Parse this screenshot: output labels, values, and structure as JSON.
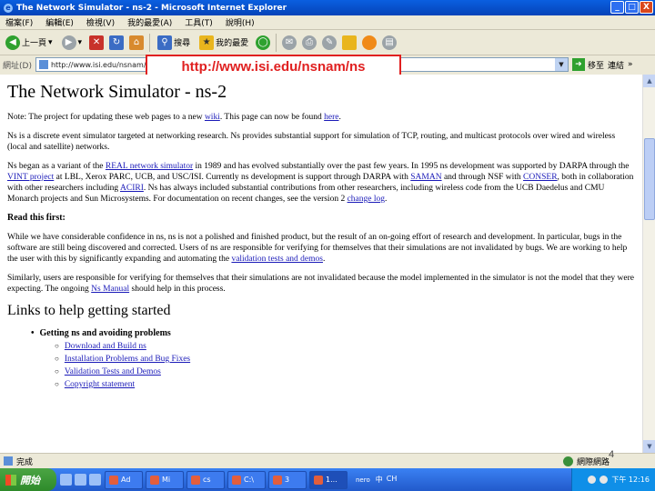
{
  "window": {
    "title": "The Network Simulator - ns-2 - Microsoft Internet Explorer",
    "controls": [
      "_",
      "□",
      "X"
    ]
  },
  "menu": [
    "檔案(F)",
    "編輯(E)",
    "檢視(V)",
    "我的最愛(A)",
    "工具(T)",
    "說明(H)"
  ],
  "toolbar": {
    "back_label": "上一頁",
    "search_label": "搜尋",
    "favorites_label": "我的最愛"
  },
  "address": {
    "label": "網址(D)",
    "value": "http://www.isi.edu/nsnam/ns/",
    "go_label": "移至",
    "links_label": "連結"
  },
  "callout": "http://www.isi.edu/nsnam/ns",
  "page": {
    "title": "The Network Simulator - ns-2",
    "note": {
      "pre": "Note: The project for updating these web pages to a new ",
      "link1": "wiki",
      "mid": ". This page can now be found ",
      "link2": "here",
      "post": "."
    },
    "p1": "Ns is a discrete event simulator targeted at networking research. Ns provides substantial support for simulation of TCP, routing, and multicast protocols over wired and wireless (local and satellite) networks.",
    "p2": {
      "a": "Ns began as a variant of the ",
      "l1": "REAL network simulator",
      "b": " in 1989 and has evolved substantially over the past few years. In 1995 ns development was supported by DARPA through the ",
      "l2": "VINT project",
      "c": " at LBL, Xerox PARC, UCB, and USC/ISI. Currently ns development is support through DARPA with ",
      "l3": "SAMAN",
      "d": " and through NSF with ",
      "l4": "CONSER",
      "e": ", both in collaboration with other researchers including ",
      "l5": "ACIRI",
      "f": ". Ns has always included substantial contributions from other researchers, including wireless code from the UCB Daedelus and CMU Monarch projects and Sun Microsystems. For documentation on recent changes, see the version 2 ",
      "l6": "change log",
      "g": "."
    },
    "read_first": "Read this first:",
    "p3": {
      "a": "While we have considerable confidence in ns, ns is not a polished and finished product, but the result of an on-going effort of research and development. In particular, bugs in the software are still being discovered and corrected. Users of ns are responsible for verifying for themselves that their simulations are not invalidated by bugs. We are working to help the user with this by significantly expanding and automating the ",
      "l1": "validation tests and demos",
      "b": "."
    },
    "p4": {
      "a": "Similarly, users are responsible for verifying for themselves that their simulations are not invalidated because the model implemented in the simulator is not the model that they were expecting. The ongoing ",
      "l1": "Ns Manual",
      "b": " should help in this process."
    },
    "links_heading": "Links to help getting started",
    "getting_started": "Getting ns and avoiding problems",
    "sub_links": [
      "Download and Build ns",
      "Installation Problems and Bug Fixes",
      "Validation Tests and Demos",
      "Copyright statement"
    ]
  },
  "status": {
    "text": "完成",
    "zone": "網際網路"
  },
  "page_number": "4",
  "taskbar": {
    "start": "開始",
    "tasks": [
      "Ad",
      "Mi",
      "cs",
      "C:\\",
      "3",
      "1..."
    ],
    "nero": "nero",
    "lang": [
      "中",
      "CH"
    ],
    "clock": "下午 12:16"
  }
}
